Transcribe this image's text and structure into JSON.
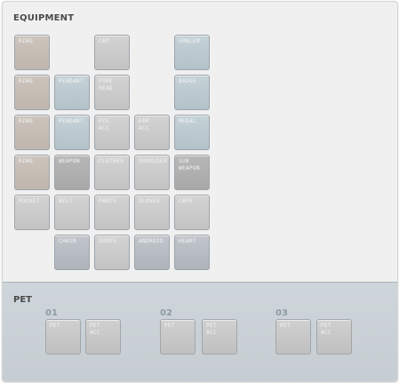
{
  "equipment": {
    "title": "EQUIPMENT",
    "slots": {
      "ring1": "RING",
      "cap": "CAP",
      "emblem": "EMBLEM",
      "ring2": "RING",
      "pendant1": "PENDANT",
      "forehead": "FORE\nHEAD",
      "badge": "BADGE",
      "ring3": "RING",
      "pendant2": "PENDANT",
      "eye_acc": "EYE\nACC",
      "ear_acc": "EAR\nACC",
      "medal": "MEDAL",
      "ring4": "RING",
      "weapon": "WEAPON",
      "clothes": "CLOTHES",
      "shoulder": "SHOULDER",
      "sub_weapon": "SUB\nWEAPON",
      "pocket": "POCKET",
      "belt": "BELT",
      "pants": "PANTS",
      "gloves": "GLOVES",
      "cape": "CAPE",
      "chair": "CHAIR",
      "shoes": "SHOES",
      "android": "ANDROID",
      "heart": "HEART"
    }
  },
  "pet": {
    "title": "PET",
    "groups": [
      {
        "number": "01",
        "pet": "PET",
        "acc": "PET\nACC"
      },
      {
        "number": "02",
        "pet": "PET",
        "acc": "PET\nACC"
      },
      {
        "number": "03",
        "pet": "PET",
        "acc": "PET\nACC"
      }
    ]
  }
}
